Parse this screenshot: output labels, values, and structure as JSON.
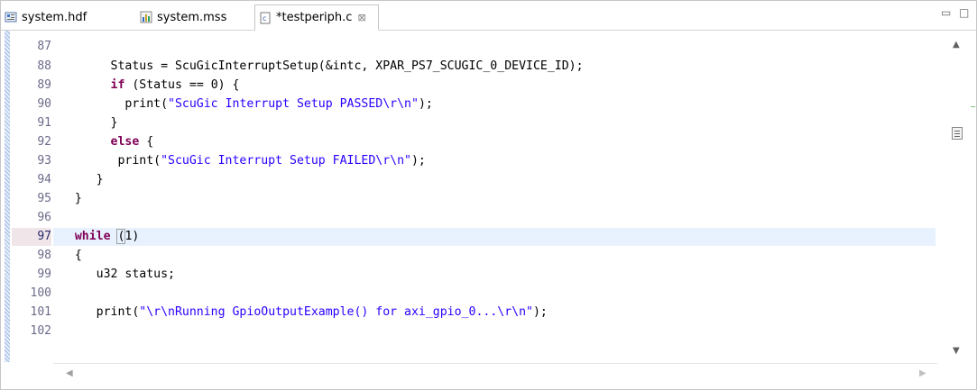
{
  "tabs": [
    {
      "label": "system.hdf",
      "icon": "hdf-file-icon",
      "active": false
    },
    {
      "label": "system.mss",
      "icon": "mss-file-icon",
      "active": false
    },
    {
      "label": "*testperiph.c",
      "icon": "c-file-icon",
      "active": true,
      "close": "⊠"
    }
  ],
  "window_controls": {
    "minimize": "▭",
    "maximize": "□"
  },
  "line_numbers": [
    "87",
    "88",
    "89",
    "90",
    "91",
    "92",
    "93",
    "94",
    "95",
    "96",
    "97",
    "98",
    "99",
    "100",
    "101",
    "102"
  ],
  "current_line": "97",
  "code": {
    "l88": "        Status = ScuGicInterruptSetup(&intc, XPAR_PS7_SCUGIC_0_DEVICE_ID);",
    "l89_kw": "if",
    "l89_rest": " (Status == 0) {",
    "l90_pre": "          print(",
    "l90_str": "\"ScuGic Interrupt Setup PASSED\\r\\n\"",
    "l90_post": ");",
    "l91": "        }",
    "l92_kw": "else",
    "l92_rest": " {",
    "l93_pre": "         print(",
    "l93_str": "\"ScuGic Interrupt Setup FAILED\\r\\n\"",
    "l93_post": ");",
    "l94": "      }",
    "l95": "   }",
    "l97_kw": "while",
    "l97_bracket": "(",
    "l97_rest": "1)",
    "l98": "   {",
    "l99": "      u32 status;",
    "l101_pre": "      print(",
    "l101_str": "\"\\r\\nRunning GpioOutputExample() for axi_gpio_0...\\r\\n\"",
    "l101_post": ");"
  },
  "colors": {
    "keyword": "#7f0055",
    "string": "#2a00ff",
    "current_line_bg": "#e8f2fe"
  }
}
